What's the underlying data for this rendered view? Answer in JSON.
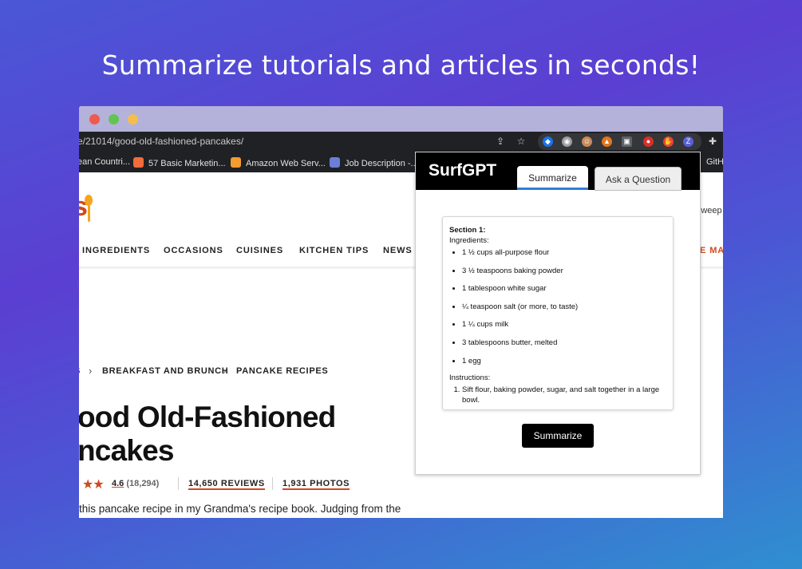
{
  "headline": "Summarize tutorials and articles in seconds!",
  "browser": {
    "url": "e/21014/good-old-fashioned-pancakes/",
    "bookmarks": [
      {
        "label": "ean Countri...",
        "color": ""
      },
      {
        "label": "57 Basic Marketin...",
        "color": "#f26b3a"
      },
      {
        "label": "Amazon Web Serv...",
        "color": "#f29b2f"
      },
      {
        "label": "Job Description -...",
        "color": "#6b7fd8"
      },
      {
        "label": "GitH",
        "color": ""
      }
    ]
  },
  "site": {
    "sweep_text": "Sweep",
    "nav": [
      "INGREDIENTS",
      "OCCASIONS",
      "CUISINES",
      "KITCHEN TIPS",
      "NEWS"
    ],
    "nav_partial": "E MA",
    "breadcrumbs": [
      "S",
      "BREAKFAST AND BRUNCH",
      "PANCAKE RECIPES"
    ],
    "title_line1": "ood Old-Fashioned",
    "title_line2": "ncakes",
    "rating_value": "4.6",
    "rating_count": "(18,294)",
    "reviews": "14,650 REVIEWS",
    "photos": "1,931 PHOTOS",
    "description": "this pancake recipe in my Grandma's recipe book. Judging from the"
  },
  "popup": {
    "brand": "SurfGPT",
    "tab_summarize": "Summarize",
    "tab_ask": "Ask a Question",
    "section_title": "Section 1:",
    "ingredients_label": "Ingredients:",
    "ingredients": [
      "1 ½ cups all-purpose flour",
      "3 ½ teaspoons baking powder",
      "1 tablespoon white sugar",
      "¼ teaspoon salt (or more, to taste)",
      "1 ¼ cups milk",
      "3 tablespoons butter, melted",
      "1 egg"
    ],
    "instructions_label": "Instructions:",
    "instructions": [
      "Sift flour, baking powder, sugar, and salt together in a large bowl."
    ],
    "button": "Summarize"
  }
}
